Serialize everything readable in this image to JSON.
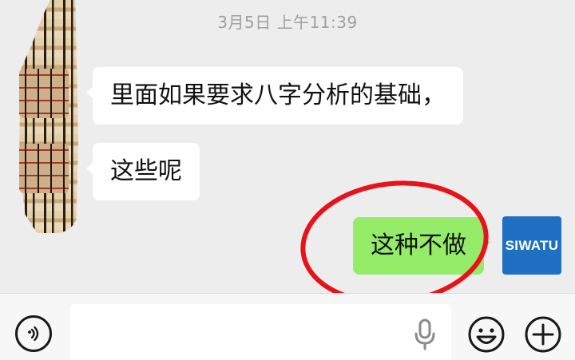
{
  "timestamp": "3月5日 上午11:39",
  "messages": [
    {
      "side": "left",
      "text": "里面如果要求八字分析的基础，"
    },
    {
      "side": "left",
      "text": "这些呢"
    },
    {
      "side": "right",
      "text": "这种不做"
    }
  ],
  "self_avatar": {
    "text": "SIWATU",
    "color": "#1f6fc2"
  },
  "annotation": {
    "shape": "ellipse",
    "color": "#e8121b"
  },
  "input_bar": {
    "voice_icon": "voice-mode-icon",
    "mic_icon": "microphone-icon",
    "emoji_icon": "emoji-icon",
    "plus_icon": "plus-icon",
    "input_value": ""
  },
  "colors": {
    "background": "#ededed",
    "sent_bubble": "#95ec69",
    "received_bubble": "#ffffff",
    "timestamp": "#a0a0a0"
  }
}
